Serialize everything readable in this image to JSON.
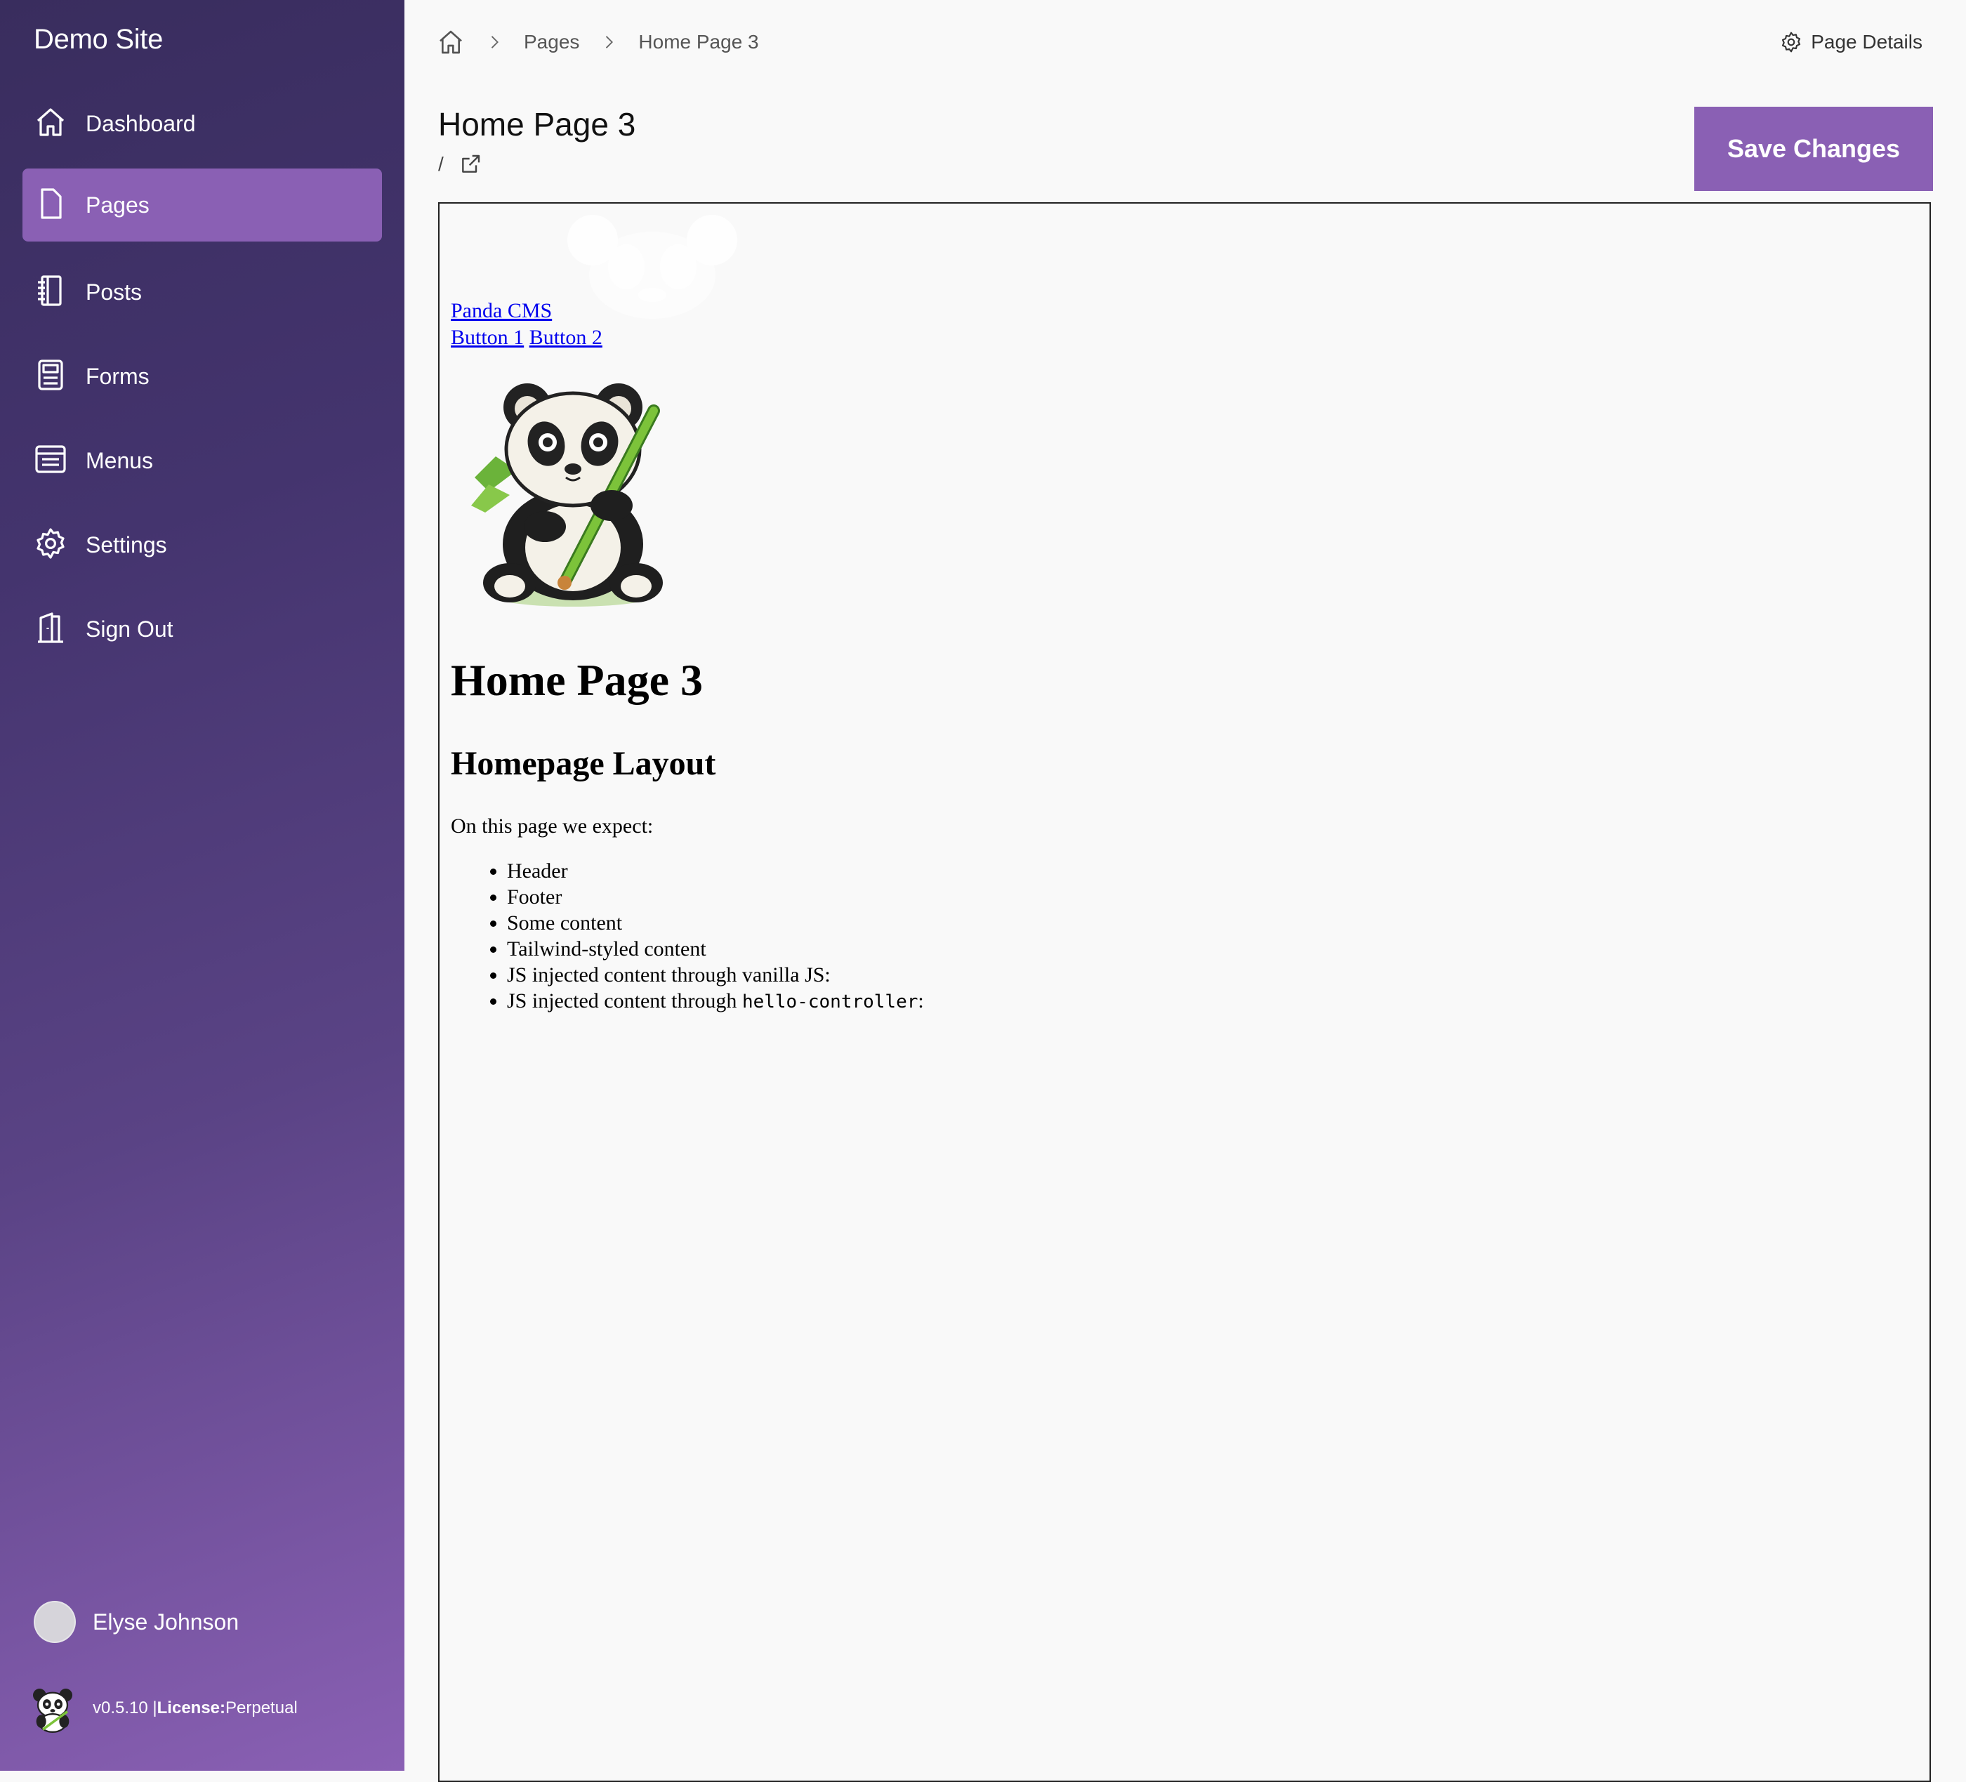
{
  "sidebar": {
    "site_title": "Demo Site",
    "items": [
      {
        "label": "Dashboard",
        "icon": "home-icon",
        "active": false
      },
      {
        "label": "Pages",
        "icon": "document-icon",
        "active": true
      },
      {
        "label": "Posts",
        "icon": "notebook-icon",
        "active": false
      },
      {
        "label": "Forms",
        "icon": "form-icon",
        "active": false
      },
      {
        "label": "Menus",
        "icon": "menu-icon",
        "active": false
      },
      {
        "label": "Settings",
        "icon": "gear-icon",
        "active": false
      },
      {
        "label": "Sign Out",
        "icon": "door-icon",
        "active": false
      }
    ],
    "user_name": "Elyse Johnson",
    "version": "v0.5.10 | ",
    "license_label": "License:",
    "license_value": " Perpetual"
  },
  "breadcrumb": {
    "items": [
      "Pages",
      "Home Page 3"
    ]
  },
  "header": {
    "page_details": "Page Details",
    "title": "Home Page 3",
    "slug": "/",
    "save_label": "Save Changes"
  },
  "preview": {
    "brand_link": "Panda CMS ",
    "button1": "Button 1",
    "button2": "Button 2",
    "h1": "Home Page 3",
    "h2": "Homepage Layout",
    "intro": "On this page we expect:",
    "list": [
      "Header",
      "Footer",
      "Some content",
      "Tailwind-styled content",
      "JS injected content through vanilla JS:",
      "JS injected content through "
    ],
    "code": "hello-controller",
    "code_suffix": ":"
  },
  "colors": {
    "accent": "#8a60b4",
    "sidebar_dark": "#392d5e",
    "link": "#0000ee"
  }
}
